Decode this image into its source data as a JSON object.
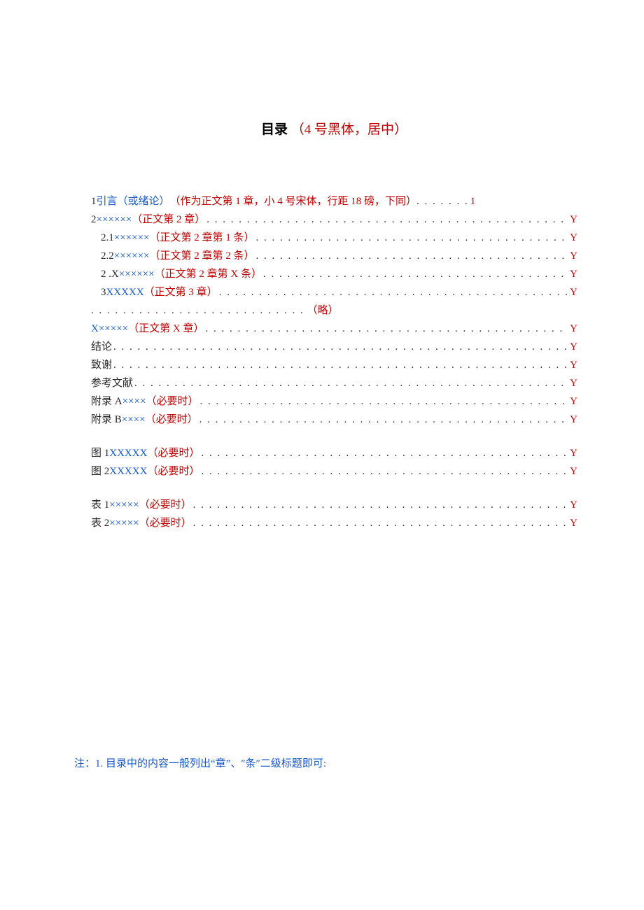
{
  "heading": {
    "black": "目录",
    "red": "（4 号黑体，居中）"
  },
  "toc": [
    {
      "type": "line",
      "prefix": "1",
      "blue": "引言（或绪论）",
      "red": "（作为正文第 1 章，小 4 号宋体，行距 18 磅，下同）",
      "page": "1",
      "indent": false,
      "shortdots": true
    },
    {
      "type": "line",
      "prefix": "2",
      "blue": "×××××× ",
      "red": "（正文第 2 章）",
      "page": "Y",
      "indent": false
    },
    {
      "type": "line",
      "prefix": "2.1   ",
      "blue": "×××××× ",
      "red": "（正文第 2 章第 1 条）",
      "page": "Y",
      "indent": true
    },
    {
      "type": "line",
      "prefix": "2.2   ",
      "blue": "×××××× ",
      "red": "（正文第 2 章第 2 条）",
      "page": "Y",
      "indent": true
    },
    {
      "type": "line",
      "prefix": "2   .X",
      "blue": "××××××",
      "red": "（正文第 2 章第 X 条）",
      "page": "Y",
      "indent": true
    },
    {
      "type": "line",
      "prefix": "3   ",
      "blue": "XXXXX",
      "red": "（正文第 3 章）",
      "page": "Y",
      "indent": true
    },
    {
      "type": "short",
      "dots": ". . . . . . . . . . . . . . . . . . . . . . . . . . .",
      "red": "（略）"
    },
    {
      "type": "line",
      "prefix": "",
      "blue": "X×××××",
      "red": "（正文第 X 章）",
      "page": "Y",
      "indent": false
    },
    {
      "type": "line",
      "prefix": "结论",
      "blue": "",
      "red": "",
      "page": "Y",
      "indent": false
    },
    {
      "type": "line",
      "prefix": "致谢",
      "blue": "",
      "red": "",
      "page": "Y",
      "indent": false
    },
    {
      "type": "line",
      "prefix": "参考文献",
      "blue": "",
      "red": "",
      "page": "Y",
      "indent": false
    },
    {
      "type": "line",
      "prefix": "附录 A",
      "blue": "××××",
      "red": "（必要时）",
      "page": "Y",
      "indent": false
    },
    {
      "type": "line",
      "prefix": "附录 B",
      "blue": "××××",
      "red": "（必要时）",
      "page": "Y",
      "indent": false
    },
    {
      "type": "gap"
    },
    {
      "type": "line",
      "prefix": "图 1",
      "blue": "XXXXX",
      "red": "（必要时）",
      "page": "Y",
      "indent": false
    },
    {
      "type": "line",
      "prefix": "图 2",
      "blue": "XXXXX",
      "red": "（必要时）",
      "page": "Y",
      "indent": false
    },
    {
      "type": "gap"
    },
    {
      "type": "line",
      "prefix": "表 1",
      "blue": "×××××",
      "red": "（必要时）",
      "page": "Y",
      "indent": false
    },
    {
      "type": "line",
      "prefix": "表 2",
      "blue": "×××××",
      "red": "（必要时）",
      "page": "Y",
      "indent": false
    }
  ],
  "footnote": "注：1.  目录中的内容一般列出“章”、″条″二级标题即可:"
}
